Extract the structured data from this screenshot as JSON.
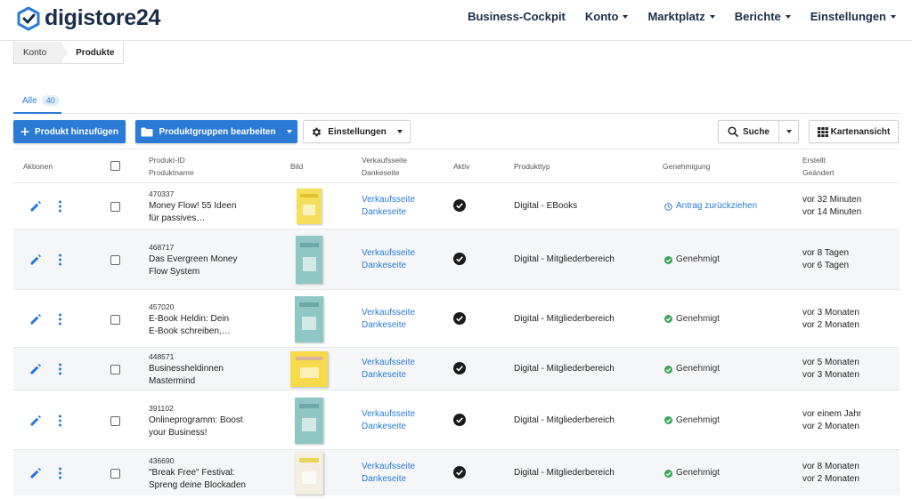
{
  "header": {
    "logo_text": "digistore24",
    "nav": [
      {
        "label": "Business-Cockpit",
        "dropdown": false
      },
      {
        "label": "Konto",
        "dropdown": true
      },
      {
        "label": "Marktplatz",
        "dropdown": true
      },
      {
        "label": "Berichte",
        "dropdown": true
      },
      {
        "label": "Einstellungen",
        "dropdown": true
      }
    ]
  },
  "breadcrumb": [
    "Konto",
    "Produkte"
  ],
  "tabs": [
    {
      "label": "Alle",
      "count": "40"
    }
  ],
  "toolbar": {
    "add_product": "Produkt hinzufügen",
    "edit_groups": "Produktgruppen bearbeiten",
    "settings": "Einstellungen",
    "search": "Suche",
    "card_view": "Kartenansicht"
  },
  "table": {
    "headers": {
      "actions": "Aktionen",
      "product_id": "Produkt-ID",
      "product_name": "Produktname",
      "image": "Bild",
      "sales_page": "Verkaufsseite",
      "thanks_page": "Dankeseite",
      "active": "Aktiv",
      "type": "Produkttyp",
      "approval": "Genehmigung",
      "created": "Erstellt",
      "changed": "Geändert"
    },
    "rows": [
      {
        "id": "470337",
        "name1": "Money Flow! 55 Ideen",
        "name2": "für passives…",
        "sales": "Verkaufsseite",
        "thanks": "Dankeseite",
        "type": "Digital - EBooks",
        "approval": "Antrag zurückziehen",
        "approval_kind": "withdraw",
        "created": "vor 32 Minuten",
        "changed": "vor 14 Minuten"
      },
      {
        "id": "468717",
        "name1": "Das Evergreen Money",
        "name2": "Flow System",
        "sales": "Verkaufsseite",
        "thanks": "Dankeseite",
        "type": "Digital - Mitgliederbereich",
        "approval": "Genehmigt",
        "approval_kind": "approved",
        "created": "vor 8 Tagen",
        "changed": "vor 6 Tagen"
      },
      {
        "id": "457020",
        "name1": "E-Book Heldin: Dein",
        "name2": "E-Book schreiben,…",
        "sales": "Verkaufsseite",
        "thanks": "Dankeseite",
        "type": "Digital - Mitgliederbereich",
        "approval": "Genehmigt",
        "approval_kind": "approved",
        "created": "vor 3 Monaten",
        "changed": "vor 2 Monaten"
      },
      {
        "id": "448571",
        "name1": "Businessheldinnen",
        "name2": "Mastermind",
        "sales": "Verkaufsseite",
        "thanks": "Dankeseite",
        "type": "Digital - Mitgliederbereich",
        "approval": "Genehmigt",
        "approval_kind": "approved",
        "created": "vor 5 Monaten",
        "changed": "vor 3 Monaten"
      },
      {
        "id": "391102",
        "name1": "Onlineprogramm: Boost",
        "name2": "your Business!",
        "sales": "Verkaufsseite",
        "thanks": "Dankeseite",
        "type": "Digital - Mitgliederbereich",
        "approval": "Genehmigt",
        "approval_kind": "approved",
        "created": "vor einem Jahr",
        "changed": "vor 2 Monaten"
      },
      {
        "id": "436690",
        "name1": "\"Break Free\" Festival:",
        "name2": "Spreng deine Blockaden",
        "sales": "Verkaufsseite",
        "thanks": "Dankeseite",
        "type": "Digital - Mitgliederbereich",
        "approval": "Genehmigt",
        "approval_kind": "approved",
        "created": "vor 8 Monaten",
        "changed": "vor 2 Monaten"
      }
    ]
  },
  "colors": {
    "primary": "#2b7bd6",
    "brand_dark": "#1c2e4a",
    "approved": "#3aa655"
  }
}
